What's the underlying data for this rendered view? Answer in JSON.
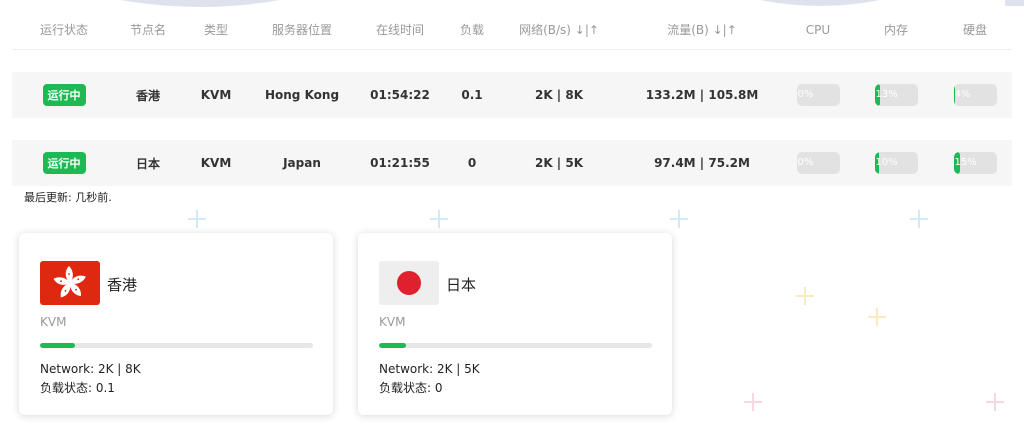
{
  "table": {
    "headers": {
      "status": "运行状态",
      "node": "节点名",
      "type": "类型",
      "location": "服务器位置",
      "uptime": "在线时间",
      "load": "负载",
      "network": "网络(B/s) ↓|↑",
      "traffic": "流量(B) ↓|↑",
      "cpu": "CPU",
      "memory": "内存",
      "disk": "硬盘"
    },
    "rows": [
      {
        "status": "运行中",
        "node": "香港",
        "type": "KVM",
        "location": "Hong Kong",
        "uptime": "01:54:22",
        "load": "0.1",
        "network": "2K | 8K",
        "traffic": "133.2M | 105.8M",
        "cpu_label": "0%",
        "cpu_pct": 0,
        "mem_label": "13%",
        "mem_pct": 13,
        "disk_label": "4%",
        "disk_pct": 4
      },
      {
        "status": "运行中",
        "node": "日本",
        "type": "KVM",
        "location": "Japan",
        "uptime": "01:21:55",
        "load": "0",
        "network": "2K | 5K",
        "traffic": "97.4M | 75.2M",
        "cpu_label": "0%",
        "cpu_pct": 0,
        "mem_label": "10%",
        "mem_pct": 10,
        "disk_label": "15%",
        "disk_pct": 15
      }
    ]
  },
  "last_updated": "最后更新: 几秒前.",
  "cards": [
    {
      "flag_icon": "hong-kong-flag-icon",
      "name": "香港",
      "type": "KVM",
      "progress_pct": 13,
      "network": "Network: 2K | 8K",
      "load": "负载状态: 0.1"
    },
    {
      "flag_icon": "japan-flag-icon",
      "name": "日本",
      "type": "KVM",
      "progress_pct": 10,
      "network": "Network: 2K | 5K",
      "load": "负载状态: 0"
    }
  ],
  "colors": {
    "accent_green": "#1db954",
    "bar_track": "#e2e2e2",
    "hk_red": "#de2910",
    "jp_red": "#e0202f"
  }
}
